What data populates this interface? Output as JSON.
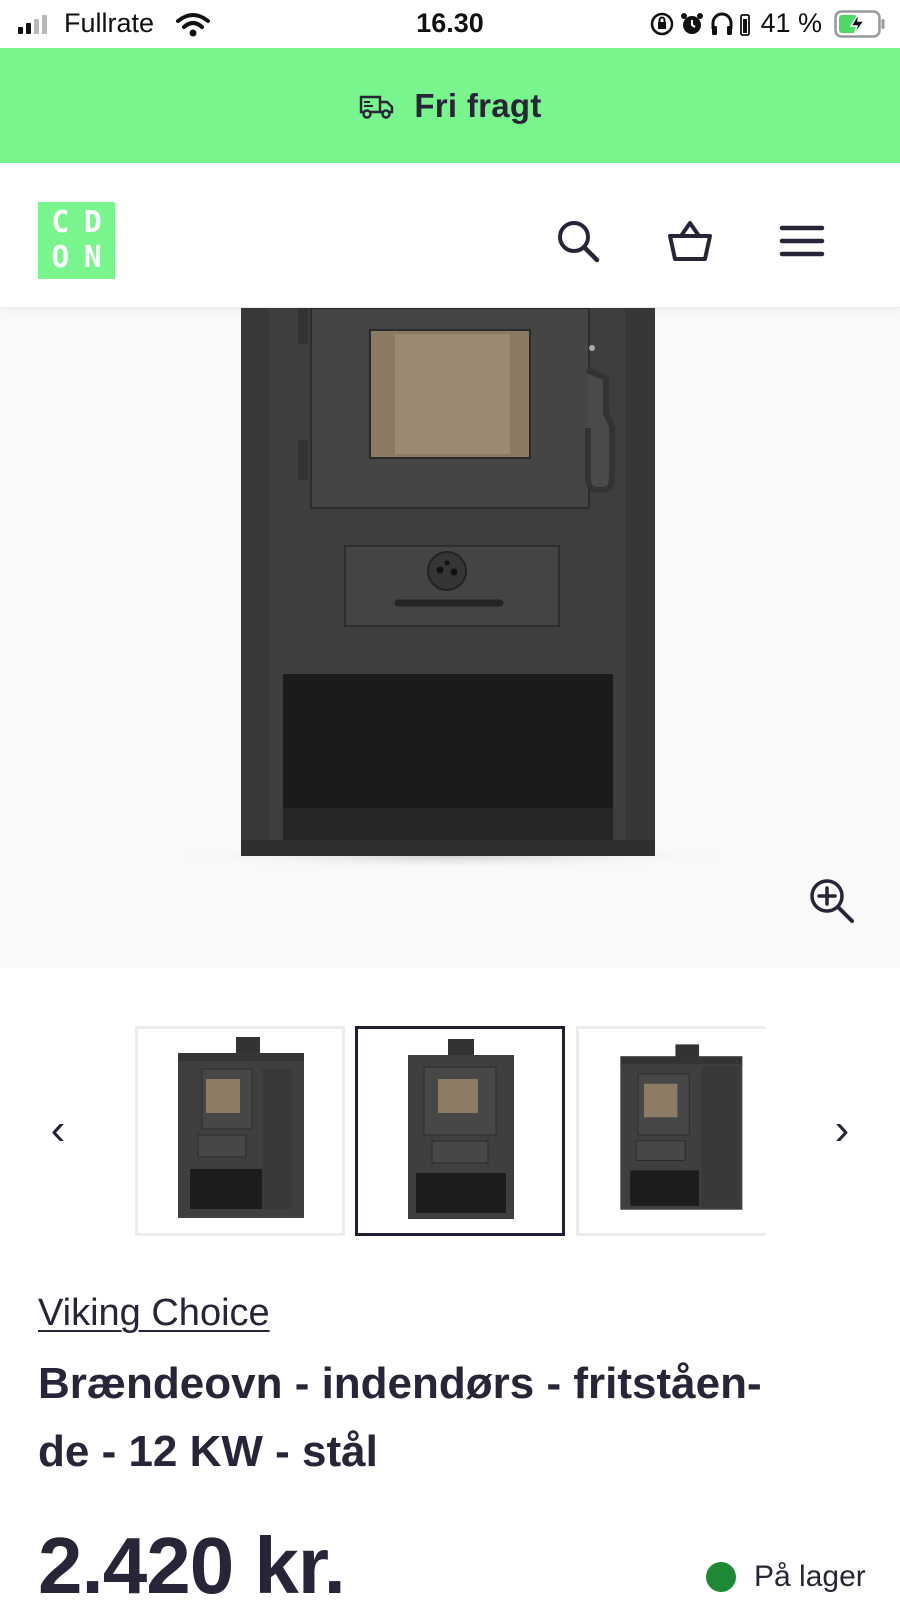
{
  "status_bar": {
    "carrier": "Fullrate",
    "time": "16.30",
    "battery_percent": "41 %"
  },
  "promo_banner": {
    "icon": "delivery-truck-icon",
    "text": "Fri fragt"
  },
  "header": {
    "logo_letters": [
      "C",
      "D",
      "O",
      "N"
    ],
    "icons": [
      "search-icon",
      "basket-icon",
      "menu-icon"
    ]
  },
  "gallery": {
    "zoom_icon": "zoom-in-icon",
    "prev_arrow": "‹",
    "next_arrow": "›",
    "thumbnails_count": 3,
    "active_thumbnail_index": 1
  },
  "product": {
    "brand": "Viking Choice",
    "title": "Brændeovn - indendørs - fritståen-de - 12 KW - stål",
    "title_line1": "Brændeovn - indendørs - fritståen-",
    "title_line2": "de - 12 KW - stål",
    "price": "2.420 kr.",
    "stock_status": "På lager"
  },
  "colors": {
    "accent_green": "#78f58c",
    "text_dark": "#2a2438",
    "stock_green": "#1e8a35"
  }
}
